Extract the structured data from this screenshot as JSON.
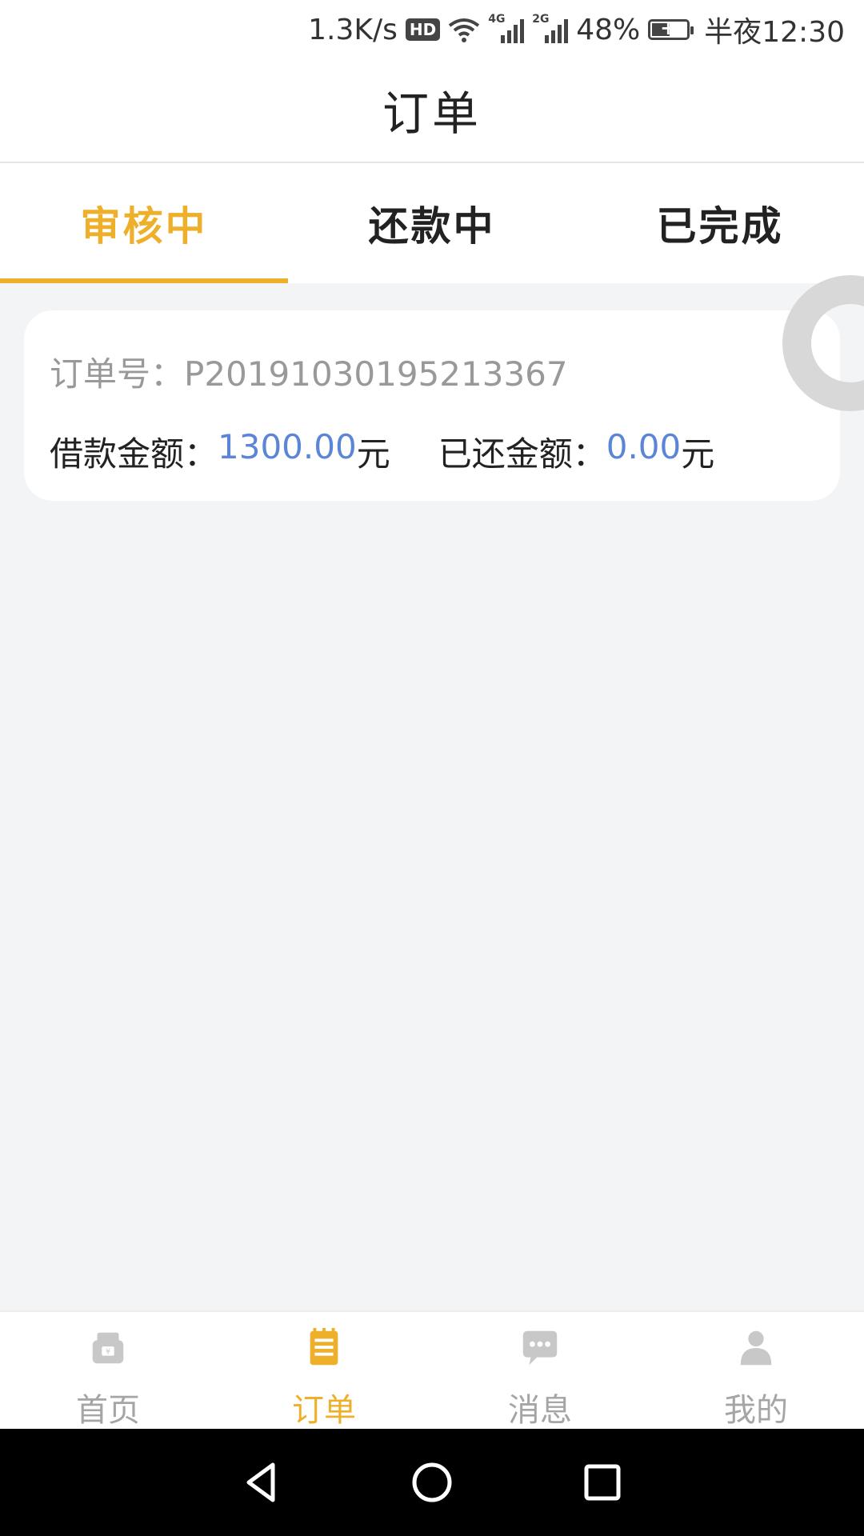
{
  "status_bar": {
    "net_speed": "1.3K/s",
    "hd": "HD",
    "sig1_tag": "4G",
    "sig2_tag": "2G",
    "battery": "48%",
    "time": "半夜12:30"
  },
  "header": {
    "title": "订单"
  },
  "tabs": [
    {
      "label": "审核中",
      "active": true
    },
    {
      "label": "还款中",
      "active": false
    },
    {
      "label": "已完成",
      "active": false
    }
  ],
  "order": {
    "number_label": "订单号：",
    "number": "P20191030195213367",
    "loan_label": "借款金额：",
    "loan_amount": "1300.00",
    "loan_unit": "元",
    "repaid_label": "已还金额：",
    "repaid_amount": "0.00",
    "repaid_unit": "元"
  },
  "bottom_nav": [
    {
      "label": "首页",
      "icon": "home-wallet-icon",
      "active": false
    },
    {
      "label": "订单",
      "icon": "order-list-icon",
      "active": true
    },
    {
      "label": "消息",
      "icon": "message-bubble-icon",
      "active": false
    },
    {
      "label": "我的",
      "icon": "person-icon",
      "active": false
    }
  ],
  "colors": {
    "accent": "#eeb02a",
    "amount": "#5b85d6",
    "muted": "#a5a5a5"
  }
}
